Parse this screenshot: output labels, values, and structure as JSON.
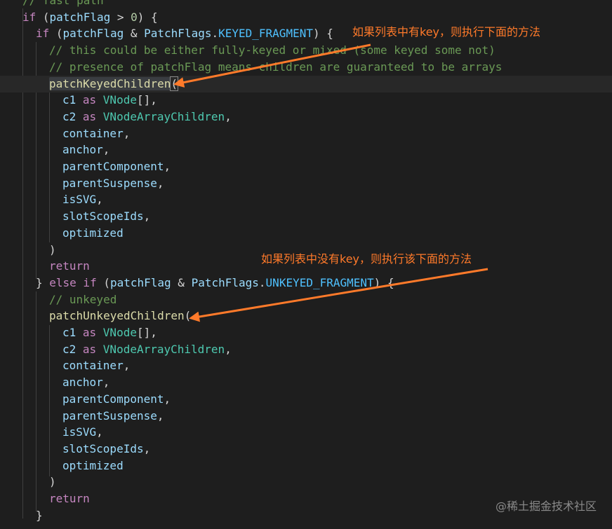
{
  "lines": [
    [
      {
        "t": "// fast path",
        "c": "cmt"
      }
    ],
    [
      {
        "t": "if",
        "c": "kw"
      },
      {
        "t": " (",
        "c": "plain"
      },
      {
        "t": "patchFlag",
        "c": "var"
      },
      {
        "t": " > ",
        "c": "op"
      },
      {
        "t": "0",
        "c": "num"
      },
      {
        "t": ") {",
        "c": "plain"
      }
    ],
    [
      {
        "t": "if",
        "c": "kw"
      },
      {
        "t": " (",
        "c": "plain"
      },
      {
        "t": "patchFlag",
        "c": "var"
      },
      {
        "t": " & ",
        "c": "op"
      },
      {
        "t": "PatchFlags",
        "c": "var"
      },
      {
        "t": ".",
        "c": "plain"
      },
      {
        "t": "KEYED_FRAGMENT",
        "c": "const"
      },
      {
        "t": ") {",
        "c": "plain"
      }
    ],
    [
      {
        "t": "// this could be either fully-keyed or mixed (some keyed some not)",
        "c": "cmt"
      }
    ],
    [
      {
        "t": "// presence of patchFlag means children are guaranteed to be arrays",
        "c": "cmt"
      }
    ],
    [
      {
        "t": "patchKeyedChildren",
        "c": "func hl"
      },
      {
        "t": "(",
        "c": "plain br-match"
      }
    ],
    [
      {
        "t": "c1",
        "c": "var"
      },
      {
        "t": " as ",
        "c": "kw"
      },
      {
        "t": "VNode",
        "c": "type"
      },
      {
        "t": "[],",
        "c": "plain"
      }
    ],
    [
      {
        "t": "c2",
        "c": "var"
      },
      {
        "t": " as ",
        "c": "kw"
      },
      {
        "t": "VNodeArrayChildren",
        "c": "type"
      },
      {
        "t": ",",
        "c": "plain"
      }
    ],
    [
      {
        "t": "container",
        "c": "var"
      },
      {
        "t": ",",
        "c": "plain"
      }
    ],
    [
      {
        "t": "anchor",
        "c": "var"
      },
      {
        "t": ",",
        "c": "plain"
      }
    ],
    [
      {
        "t": "parentComponent",
        "c": "var"
      },
      {
        "t": ",",
        "c": "plain"
      }
    ],
    [
      {
        "t": "parentSuspense",
        "c": "var"
      },
      {
        "t": ",",
        "c": "plain"
      }
    ],
    [
      {
        "t": "isSVG",
        "c": "var"
      },
      {
        "t": ",",
        "c": "plain"
      }
    ],
    [
      {
        "t": "slotScopeIds",
        "c": "var"
      },
      {
        "t": ",",
        "c": "plain"
      }
    ],
    [
      {
        "t": "optimized",
        "c": "var"
      }
    ],
    [
      {
        "t": ")",
        "c": "plain"
      }
    ],
    [
      {
        "t": "return",
        "c": "kw"
      }
    ],
    [
      {
        "t": "} ",
        "c": "plain"
      },
      {
        "t": "else if",
        "c": "kw"
      },
      {
        "t": " (",
        "c": "plain"
      },
      {
        "t": "patchFlag",
        "c": "var"
      },
      {
        "t": " & ",
        "c": "op"
      },
      {
        "t": "PatchFlags",
        "c": "var"
      },
      {
        "t": ".",
        "c": "plain"
      },
      {
        "t": "UNKEYED_FRAGMENT",
        "c": "const"
      },
      {
        "t": ") {",
        "c": "plain"
      }
    ],
    [
      {
        "t": "// unkeyed",
        "c": "cmt"
      }
    ],
    [
      {
        "t": "patchUnkeyedChildren",
        "c": "func"
      },
      {
        "t": "(",
        "c": "plain"
      }
    ],
    [
      {
        "t": "c1",
        "c": "var"
      },
      {
        "t": " as ",
        "c": "kw"
      },
      {
        "t": "VNode",
        "c": "type"
      },
      {
        "t": "[],",
        "c": "plain"
      }
    ],
    [
      {
        "t": "c2",
        "c": "var"
      },
      {
        "t": " as ",
        "c": "kw"
      },
      {
        "t": "VNodeArrayChildren",
        "c": "type"
      },
      {
        "t": ",",
        "c": "plain"
      }
    ],
    [
      {
        "t": "container",
        "c": "var"
      },
      {
        "t": ",",
        "c": "plain"
      }
    ],
    [
      {
        "t": "anchor",
        "c": "var"
      },
      {
        "t": ",",
        "c": "plain"
      }
    ],
    [
      {
        "t": "parentComponent",
        "c": "var"
      },
      {
        "t": ",",
        "c": "plain"
      }
    ],
    [
      {
        "t": "parentSuspense",
        "c": "var"
      },
      {
        "t": ",",
        "c": "plain"
      }
    ],
    [
      {
        "t": "isSVG",
        "c": "var"
      },
      {
        "t": ",",
        "c": "plain"
      }
    ],
    [
      {
        "t": "slotScopeIds",
        "c": "var"
      },
      {
        "t": ",",
        "c": "plain"
      }
    ],
    [
      {
        "t": "optimized",
        "c": "var"
      }
    ],
    [
      {
        "t": ")",
        "c": "plain"
      }
    ],
    [
      {
        "t": "return",
        "c": "kw"
      }
    ],
    [
      {
        "t": "}",
        "c": "plain"
      }
    ]
  ],
  "annotations": {
    "keyed": "如果列表中有key，则执行下面的方法",
    "unkeyed": "如果列表中没有key，则执行该下面的方法"
  },
  "watermark": "@稀土掘金技术社区",
  "colors": {
    "background": "#1e1e1e",
    "comment": "#6a9955",
    "keyword": "#c586c0",
    "variable": "#9cdcfe",
    "type": "#4ec9b0",
    "constant": "#4fc1ff",
    "function": "#dcdcaa",
    "number": "#b5cea8",
    "annotation": "#ff7a2a"
  }
}
